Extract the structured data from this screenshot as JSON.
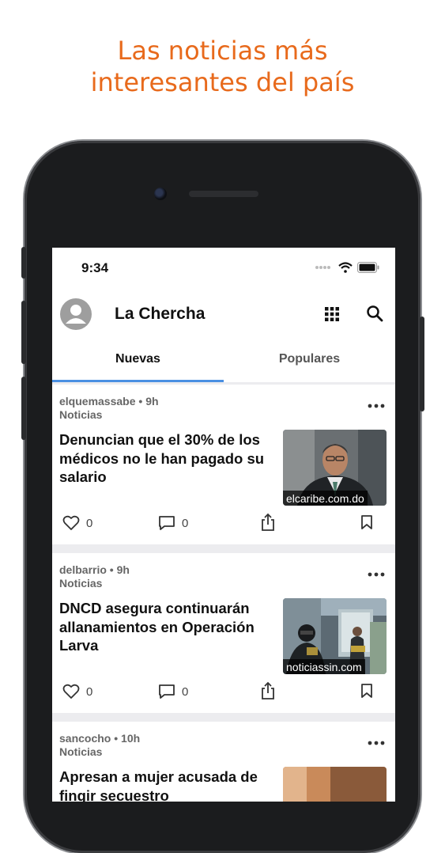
{
  "headline": {
    "line1": "Las noticias más",
    "line2": "interesantes del país"
  },
  "colors": {
    "accent": "#e86a1c",
    "tab_indicator": "#4a90e2"
  },
  "status_bar": {
    "time": "9:34"
  },
  "app_bar": {
    "title": "La Chercha",
    "icons": [
      "avatar-icon",
      "grid-icon",
      "search-icon"
    ]
  },
  "tabs": [
    {
      "label": "Nuevas",
      "selected": true
    },
    {
      "label": "Populares",
      "selected": false
    }
  ],
  "feed": [
    {
      "author": "elquemassabe",
      "time": "9h",
      "category": "Noticias",
      "title": "Denuncian que el 30% de los médicos no le han pagado su salario",
      "source": "elcaribe.com.do",
      "likes": "0",
      "comments": "0"
    },
    {
      "author": "delbarrio",
      "time": "9h",
      "category": "Noticias",
      "title": "DNCD asegura continuarán allanamientos en Operación Larva",
      "source": "noticiassin.com",
      "likes": "0",
      "comments": "0"
    },
    {
      "author": "sancocho",
      "time": "10h",
      "category": "Noticias",
      "title": "Apresan a mujer acusada de fingir secuestro"
    }
  ],
  "separator": "•"
}
